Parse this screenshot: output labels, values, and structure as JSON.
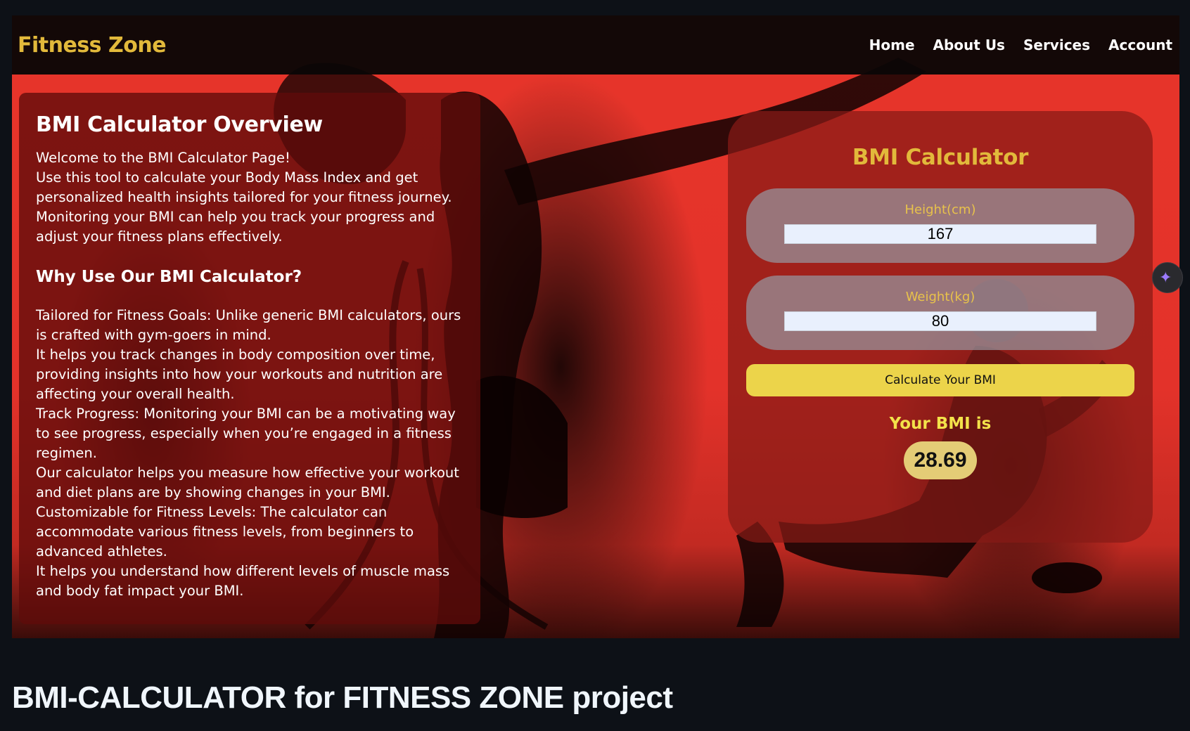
{
  "navbar": {
    "brand": "Fitness Zone",
    "links": [
      "Home",
      "About Us",
      "Services",
      "Account"
    ]
  },
  "overview": {
    "title": "BMI Calculator Overview",
    "intro": [
      "Welcome to the BMI Calculator Page!",
      "Use this tool to calculate your Body Mass Index and get personalized health insights tailored for your fitness journey.",
      "Monitoring your BMI can help you track your progress and adjust your fitness plans effectively."
    ],
    "why_heading": "Why Use Our BMI Calculator?",
    "reasons": [
      "Tailored for Fitness Goals: Unlike generic BMI calculators, ours is crafted with gym-goers in mind.",
      "It helps you track changes in body composition over time, providing insights into how your workouts and nutrition are affecting your overall health.",
      "Track Progress: Monitoring your BMI can be a motivating way to see progress, especially when you’re engaged in a fitness regimen.",
      "Our calculator helps you measure how effective your workout and diet plans are by showing changes in your BMI.",
      "Customizable for Fitness Levels: The calculator can accommodate various fitness levels, from beginners to advanced athletes.",
      "It helps you understand how different levels of muscle mass and body fat impact your BMI."
    ]
  },
  "calculator": {
    "title": "BMI Calculator",
    "height_label": "Height(cm)",
    "height_value": "167",
    "weight_label": "Weight(kg)",
    "weight_value": "80",
    "button_label": "Calculate Your BMI",
    "result_label": "Your BMI is",
    "result_value": "28.69"
  },
  "side_widget_icon": "sparkle-icon",
  "repo_title": "BMI-CALCULATOR for FITNESS ZONE project",
  "colors": {
    "page_bg": "#0d1117",
    "brand": "#e2b93b",
    "hero_red": "#e3322a",
    "button": "#ecd44a",
    "result_badge": "#e4cc76"
  }
}
